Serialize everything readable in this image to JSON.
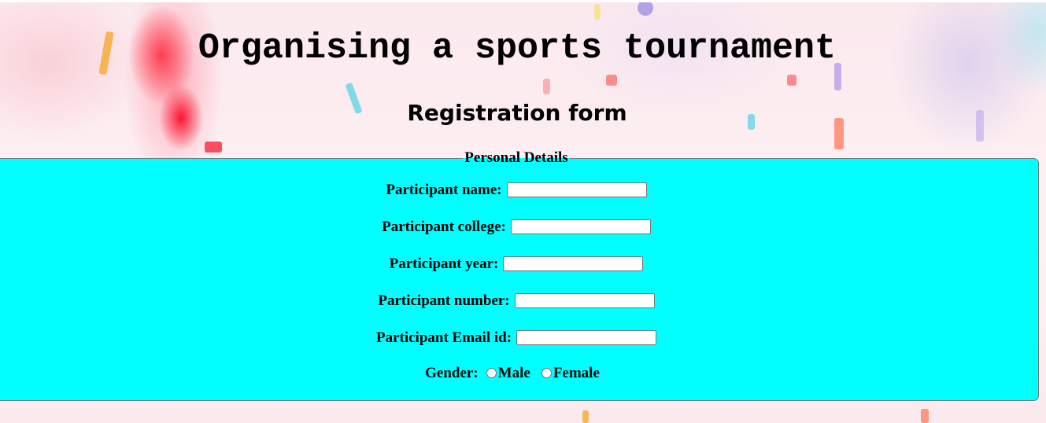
{
  "header": {
    "title": "Organising a sports tournament",
    "subtitle": "Registration form"
  },
  "form": {
    "legend": "Personal Details",
    "fields": [
      {
        "label": "Participant name:",
        "value": "",
        "placeholder": ""
      },
      {
        "label": "Participant college:",
        "value": "",
        "placeholder": ""
      },
      {
        "label": "Participant year:",
        "value": "",
        "placeholder": ""
      },
      {
        "label": "Participant number:",
        "value": "",
        "placeholder": ""
      },
      {
        "label": "Participant Email id:",
        "value": "",
        "placeholder": ""
      }
    ],
    "gender": {
      "label": "Gender:",
      "options": [
        "Male",
        "Female"
      ],
      "selected": ""
    }
  },
  "colors": {
    "fieldset_background": "#00ffff",
    "page_background": "#fbeef0"
  }
}
